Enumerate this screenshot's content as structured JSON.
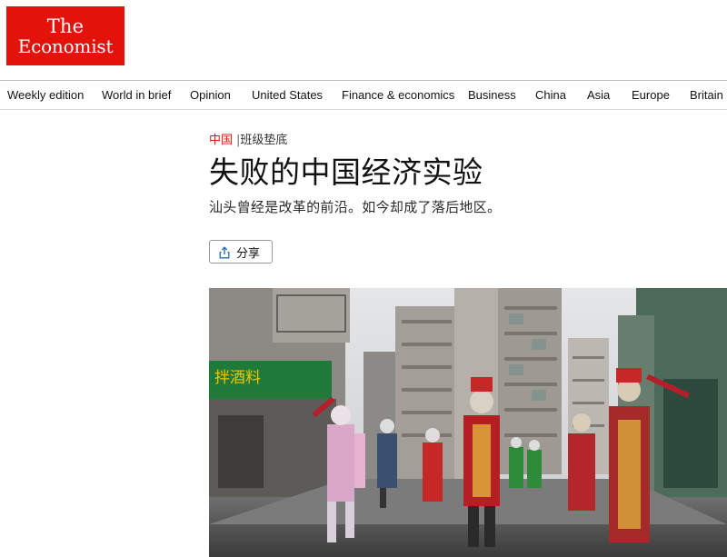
{
  "masthead": {
    "logo_line1": "The",
    "logo_line2": "Economist",
    "brand_color": "#e3120b"
  },
  "nav": {
    "items": [
      {
        "label": "Weekly edition"
      },
      {
        "label": "World in brief"
      },
      {
        "label": "Opinion"
      },
      {
        "label": "United States"
      },
      {
        "label": "Finance & economics"
      },
      {
        "label": "Business"
      },
      {
        "label": "China"
      },
      {
        "label": "Asia"
      },
      {
        "label": "Europe"
      },
      {
        "label": "Britain"
      }
    ]
  },
  "article": {
    "section": "中国",
    "separator": "|",
    "flytitle": "班级垫底",
    "headline": "失败的中国经济实验",
    "standfirst": "汕头曾经是改革的前沿。如今却成了落后地区。",
    "share_label": "分享",
    "share_icon": "share-icon",
    "photo_shop_sign": "拌酒料"
  }
}
